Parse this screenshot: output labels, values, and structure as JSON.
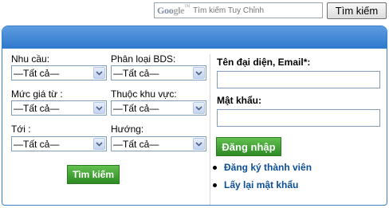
{
  "search": {
    "logo_text_1": "Goo",
    "logo_text_2": "gle",
    "logo_tm": "TM",
    "placeholder": "Tìm kiếm Tuy Chỉnh",
    "button_label": "Tìm kiếm"
  },
  "filters": {
    "need_label": "Nhu cầu:",
    "type_label": "Phân loại BDS:",
    "price_label": "Mức giá từ :",
    "area_label": "Thuộc khu vực:",
    "to_label": "Tới :",
    "direction_label": "Hướng:",
    "need_value": "—Tất cả—",
    "type_value": "—Tất cả—",
    "price_value": "—Tất cả—",
    "area_value": "—Tất cả—",
    "to_value": "—Tất cả—",
    "direction_value": "—Tất cả—",
    "search_button": "Tìm kiếm"
  },
  "login": {
    "username_label": "Tên đại diện, Email*:",
    "password_label": "Mật khẩu:",
    "login_button": "Đăng nhập",
    "register_link": "Đăng ký thành viên",
    "recover_link": "Lấy lại mật khẩu"
  },
  "colors": {
    "header_blue": "#2f78cc",
    "button_green": "#2e8a23",
    "link_blue": "#0b4f96"
  }
}
